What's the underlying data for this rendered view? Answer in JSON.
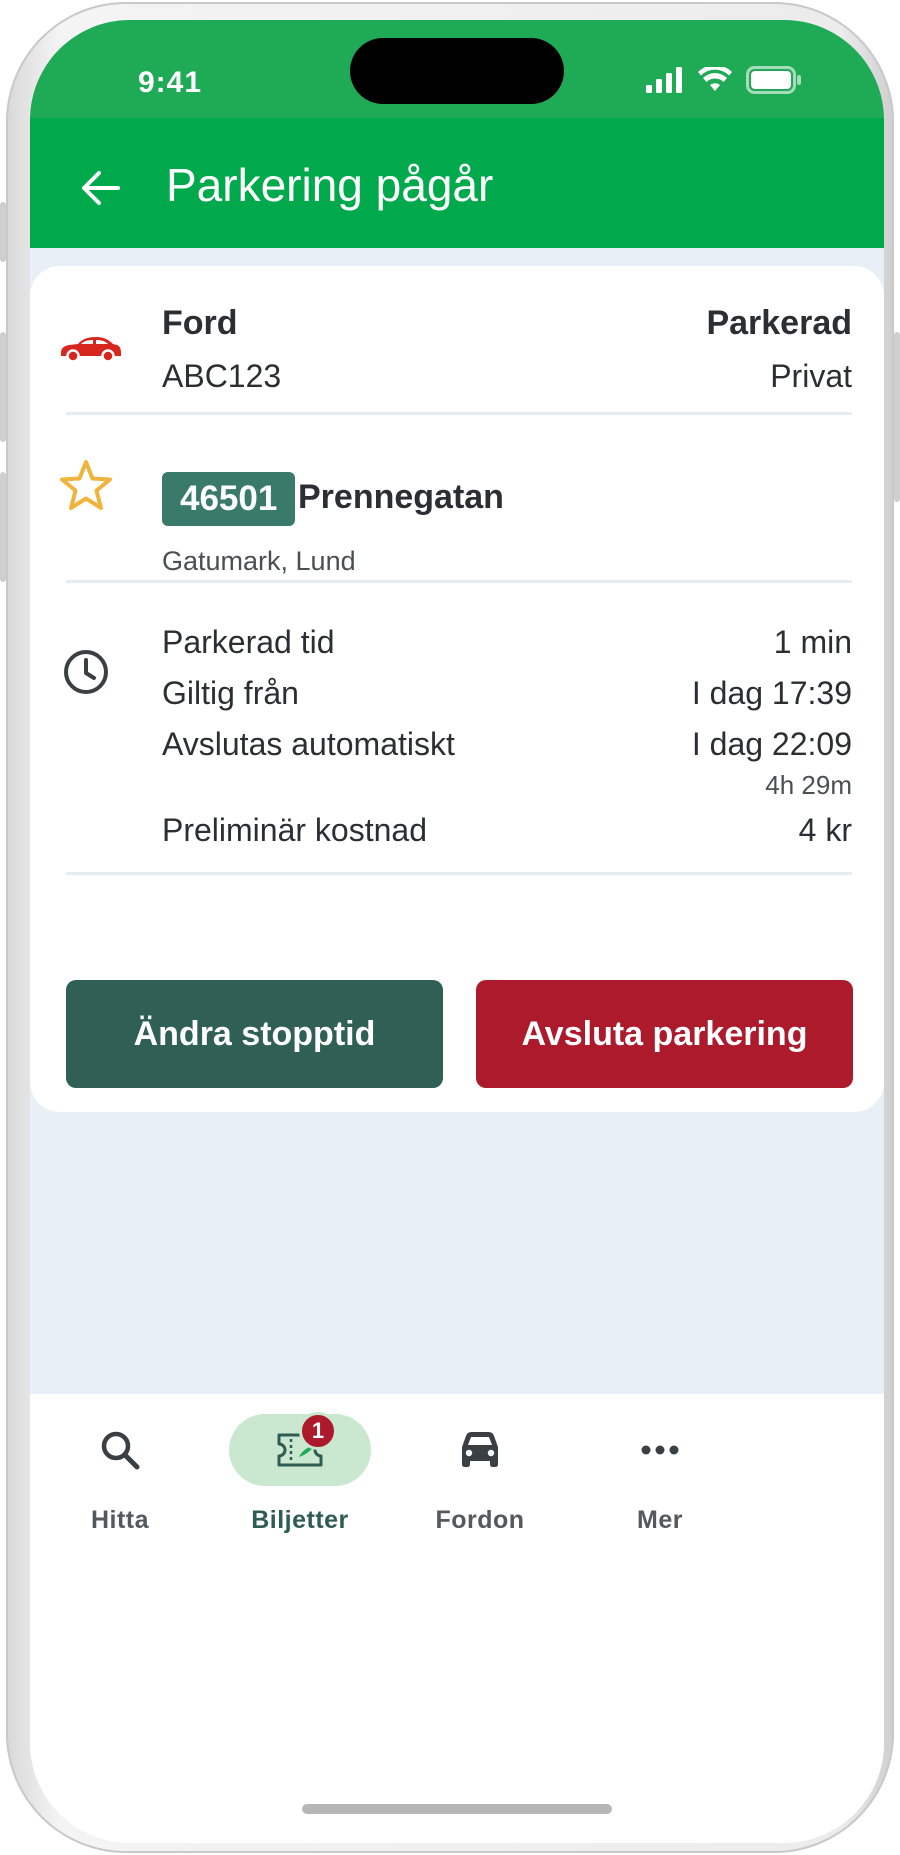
{
  "status_bar": {
    "time": "9:41"
  },
  "header": {
    "title": "Parkering pågår"
  },
  "vehicle": {
    "brand": "Ford",
    "plate": "ABC123",
    "status": "Parkerad",
    "type": "Privat",
    "icon": "car-icon"
  },
  "zone": {
    "code": "46501",
    "name": "Prennegatan",
    "subtitle": "Gatumark, Lund",
    "icon": "star-icon"
  },
  "times": {
    "icon": "clock-icon",
    "rows": [
      {
        "label": "Parkerad tid",
        "value": "1 min"
      },
      {
        "label": "Giltig från",
        "value": "I dag 17:39"
      },
      {
        "label": "Avslutas automatiskt",
        "value": "I dag 22:09",
        "subvalue": "4h 29m"
      },
      {
        "label": "Preliminär kostnad",
        "value": "4 kr"
      }
    ]
  },
  "actions": {
    "change_label": "Ändra stopptid",
    "end_label": "Avsluta parkering"
  },
  "bottom_nav": {
    "items": [
      {
        "label": "Hitta",
        "icon": "search-icon"
      },
      {
        "label": "Biljetter",
        "icon": "ticket-icon",
        "badge": "1",
        "active": true
      },
      {
        "label": "Fordon",
        "icon": "car-icon"
      },
      {
        "label": "Mer",
        "icon": "more-icon"
      }
    ]
  },
  "colors": {
    "header_green": "#00a94b",
    "zone_badge": "#3a7a6a",
    "change_button": "#305f55",
    "end_button": "#ac1a2c",
    "car_red": "#d7261e",
    "star_yellow": "#f0b43c"
  }
}
